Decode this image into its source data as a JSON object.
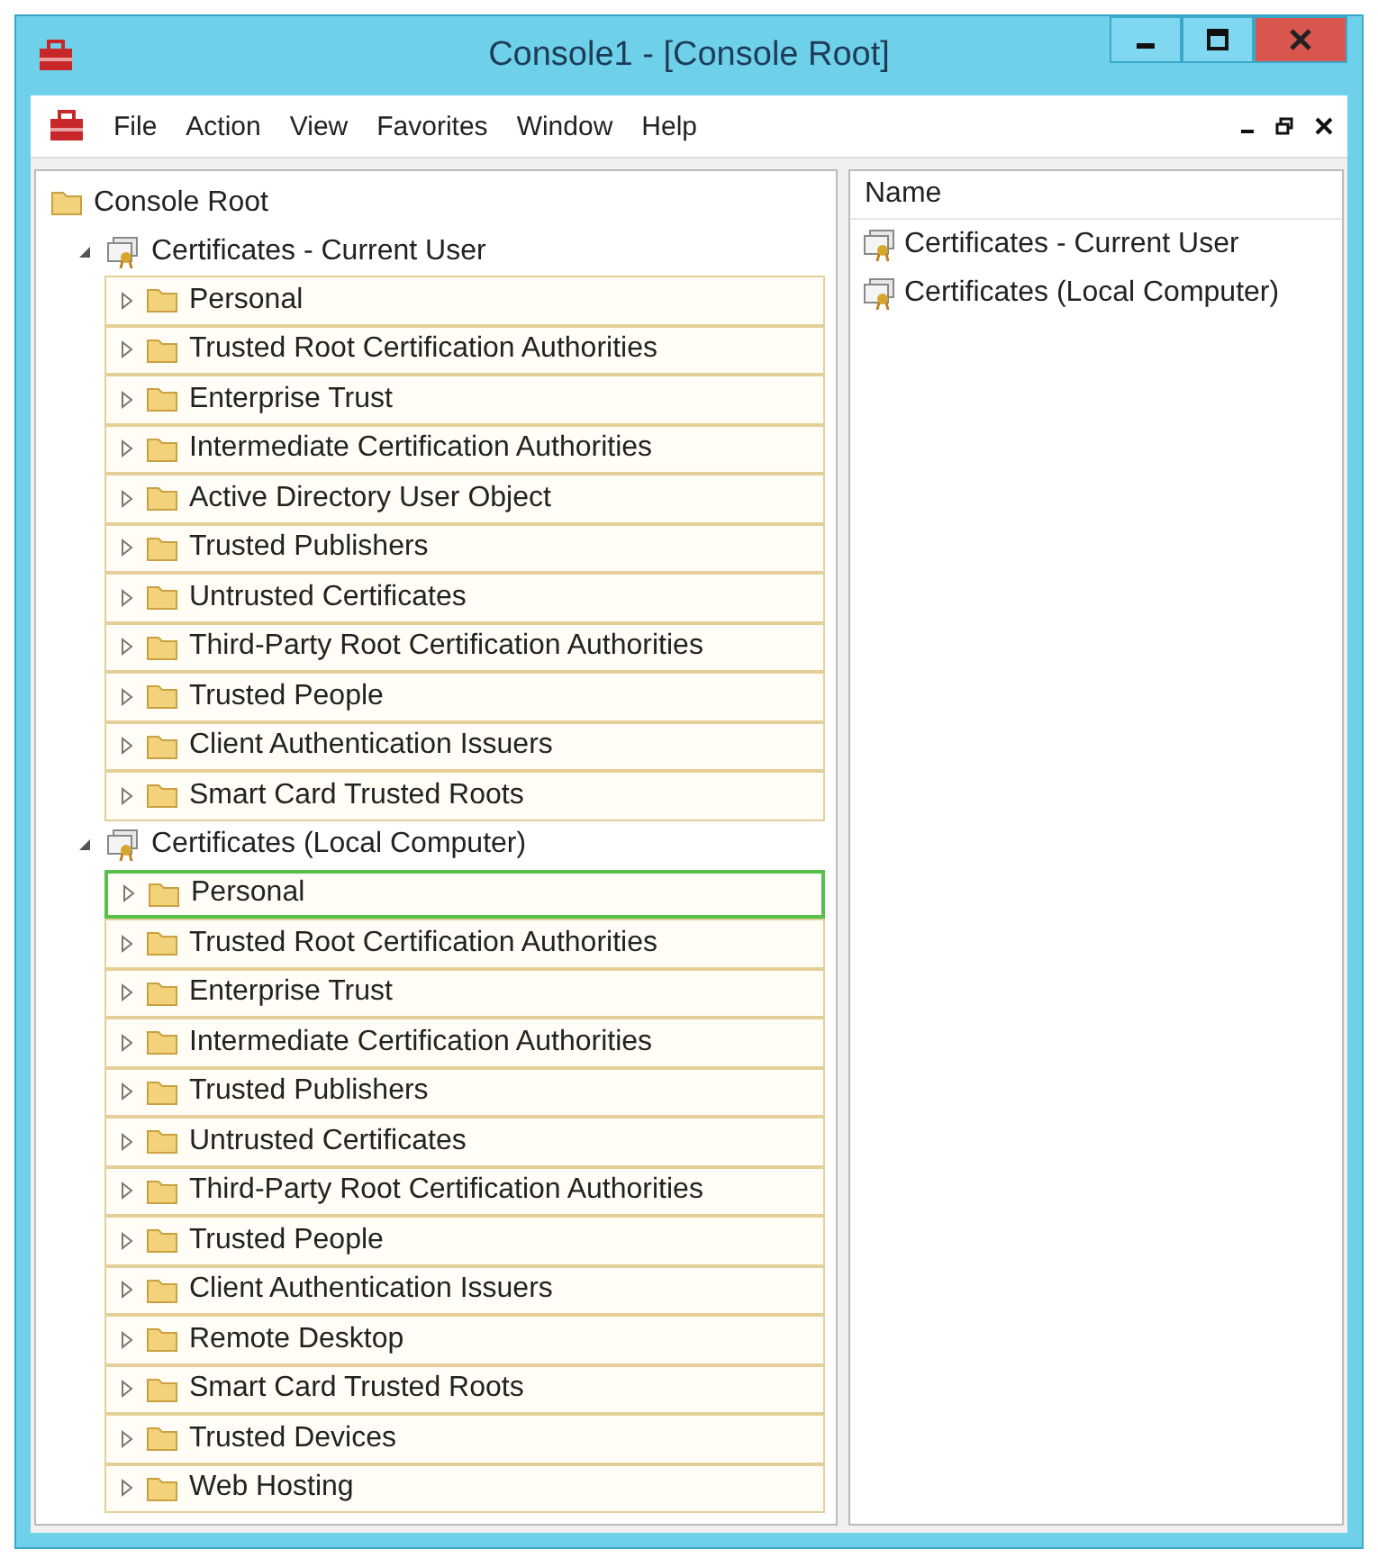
{
  "window": {
    "title": "Console1 - [Console Root]"
  },
  "menu": [
    "File",
    "Action",
    "View",
    "Favorites",
    "Window",
    "Help"
  ],
  "tree": {
    "label": "Console Root",
    "children": [
      {
        "label": "Certificates - Current User",
        "expanded": true,
        "children": [
          {
            "label": "Personal",
            "selected": false,
            "expanded": false
          },
          {
            "label": "Trusted Root Certification Authorities",
            "selected": false,
            "expanded": false
          },
          {
            "label": "Enterprise Trust",
            "selected": false,
            "expanded": false
          },
          {
            "label": "Intermediate Certification Authorities",
            "selected": false,
            "expanded": false
          },
          {
            "label": "Active Directory User Object",
            "selected": false,
            "expanded": false
          },
          {
            "label": "Trusted Publishers",
            "selected": false,
            "expanded": false
          },
          {
            "label": "Untrusted Certificates",
            "selected": false,
            "expanded": false
          },
          {
            "label": "Third-Party Root Certification Authorities",
            "selected": false,
            "expanded": false
          },
          {
            "label": "Trusted People",
            "selected": false,
            "expanded": false
          },
          {
            "label": "Client Authentication Issuers",
            "selected": false,
            "expanded": false
          },
          {
            "label": "Smart Card Trusted Roots",
            "selected": false,
            "expanded": false
          }
        ]
      },
      {
        "label": "Certificates (Local Computer)",
        "expanded": true,
        "children": [
          {
            "label": "Personal",
            "selected": true,
            "expanded": false
          },
          {
            "label": "Trusted Root Certification Authorities",
            "selected": false,
            "expanded": false
          },
          {
            "label": "Enterprise Trust",
            "selected": false,
            "expanded": false
          },
          {
            "label": "Intermediate Certification Authorities",
            "selected": false,
            "expanded": false
          },
          {
            "label": "Trusted Publishers",
            "selected": false,
            "expanded": false
          },
          {
            "label": "Untrusted Certificates",
            "selected": false,
            "expanded": false
          },
          {
            "label": "Third-Party Root Certification Authorities",
            "selected": false,
            "expanded": false
          },
          {
            "label": "Trusted People",
            "selected": false,
            "expanded": false
          },
          {
            "label": "Client Authentication Issuers",
            "selected": false,
            "expanded": false
          },
          {
            "label": "Remote Desktop",
            "selected": false,
            "expanded": false
          },
          {
            "label": "Smart Card Trusted Roots",
            "selected": false,
            "expanded": false
          },
          {
            "label": "Trusted Devices",
            "selected": false,
            "expanded": false
          },
          {
            "label": "Web Hosting",
            "selected": false,
            "expanded": false
          }
        ]
      }
    ]
  },
  "list": {
    "columns": [
      "Name"
    ],
    "rows": [
      "Certificates - Current User",
      "Certificates (Local Computer)"
    ]
  }
}
